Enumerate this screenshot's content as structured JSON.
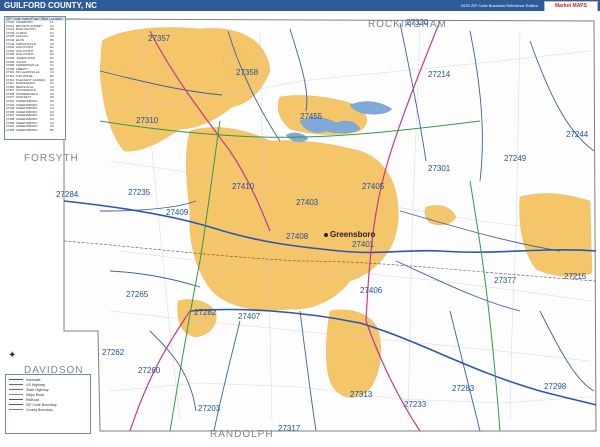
{
  "header": {
    "title": "GUILFORD COUNTY, NC",
    "edition": "2020 ZIP Code Business Reference Edition",
    "logo_text": "Market MAPS"
  },
  "counties": [
    "FORSYTH",
    "ROCKINGHAM",
    "DAVIDSON",
    "RANDOLPH"
  ],
  "city": "Greensboro",
  "zip_labels": [
    "27357",
    "27320",
    "27358",
    "27214",
    "27310",
    "27455",
    "27244",
    "27249",
    "27301",
    "27410",
    "27405",
    "27235",
    "27284",
    "27409",
    "27403",
    "27408",
    "27401",
    "27377",
    "27215",
    "27265",
    "27406",
    "27282",
    "27407",
    "27262",
    "27260",
    "27283",
    "27298",
    "27313",
    "27233",
    "27203",
    "27317"
  ],
  "legend": {
    "header": "ZIP Code Index/Post Office Location",
    "rows": [
      [
        "27203",
        "ASHEBORO",
        "F1"
      ],
      [
        "27214",
        "BROWNS SUMMIT",
        "A4"
      ],
      [
        "27215",
        "BURLINGTON",
        "D6"
      ],
      [
        "27233",
        "CLIMAX",
        "F4"
      ],
      [
        "27235",
        "COLFAX",
        "C2"
      ],
      [
        "27244",
        "ELON",
        "B6"
      ],
      [
        "27249",
        "GIBSONVILLE",
        "C5"
      ],
      [
        "27260",
        "HIGH POINT",
        "E2"
      ],
      [
        "27262",
        "HIGH POINT",
        "E1"
      ],
      [
        "27265",
        "HIGH POINT",
        "D2"
      ],
      [
        "27282",
        "JAMESTOWN",
        "D2"
      ],
      [
        "27283",
        "JULIAN",
        "E4"
      ],
      [
        "27284",
        "KERNERSVILLE",
        "C1"
      ],
      [
        "27298",
        "LIBERTY",
        "E5"
      ],
      [
        "27301",
        "MC LEANSVILLE",
        "C4"
      ],
      [
        "27310",
        "OAK RIDGE",
        "B2"
      ],
      [
        "27313",
        "PLEASANT GARDEN",
        "E3"
      ],
      [
        "27317",
        "RANDLEMAN",
        "F3"
      ],
      [
        "27320",
        "REIDSVILLE",
        "A4"
      ],
      [
        "27357",
        "STOKESDALE",
        "A2"
      ],
      [
        "27358",
        "SUMMERFIELD",
        "A3"
      ],
      [
        "27377",
        "WHITSETT",
        "D5"
      ],
      [
        "27401",
        "GREENSBORO",
        "D3"
      ],
      [
        "27403",
        "GREENSBORO",
        "C3"
      ],
      [
        "27405",
        "GREENSBORO",
        "C4"
      ],
      [
        "27406",
        "GREENSBORO",
        "D3"
      ],
      [
        "27407",
        "GREENSBORO",
        "D3"
      ],
      [
        "27408",
        "GREENSBORO",
        "C3"
      ],
      [
        "27409",
        "GREENSBORO",
        "C2"
      ],
      [
        "27410",
        "GREENSBORO",
        "C3"
      ],
      [
        "27455",
        "GREENSBORO",
        "B3"
      ]
    ]
  },
  "map_key": {
    "items": [
      "Interstate",
      "US Highway",
      "State Highway",
      "Major Road",
      "Railroad",
      "ZIP Code Boundary",
      "County Boundary"
    ],
    "colors": [
      "#2a56b8",
      "#c43a8f",
      "#2f9c4a",
      "#8b8b8b",
      "#555555",
      "#3d5fae",
      "#7f7f7f"
    ]
  },
  "colors": {
    "urban": "#f5c56a",
    "water": "#7fa9d8",
    "boundary": "#3d5fae",
    "interstate": "#2a56b8",
    "us_highway": "#c43a8f",
    "state_highway": "#2f9c4a"
  }
}
